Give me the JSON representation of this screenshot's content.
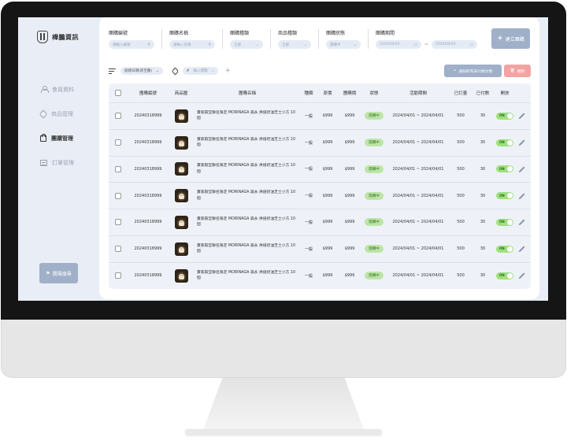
{
  "app": {
    "logo_text": "樺鵬資訊"
  },
  "sidebar": {
    "items": [
      {
        "label": "會員資料",
        "icon": "user-icon",
        "active": false
      },
      {
        "label": "商品管理",
        "icon": "tag-icon",
        "active": false
      },
      {
        "label": "團購管理",
        "icon": "bag-icon",
        "active": true
      },
      {
        "label": "訂單管理",
        "icon": "order-icon",
        "active": false
      }
    ],
    "bottom_button": "開場搜尋"
  },
  "filters": {
    "id": {
      "label": "團購編號",
      "placeholder": "請輸入編號"
    },
    "name": {
      "label": "團購名稱",
      "placeholder": "請輸入名稱"
    },
    "type": {
      "label": "團購種類",
      "value": "全部"
    },
    "product_type": {
      "label": "商品種類",
      "value": "全部"
    },
    "status": {
      "label": "團購狀態",
      "value": "團購中"
    },
    "period": {
      "label": "團購期間",
      "start": "2024/04/01",
      "end": "2024/04/01",
      "sep": "~"
    }
  },
  "actions": {
    "create": "建立團購",
    "notify": "通知所有未付款付款",
    "delete": "刪除"
  },
  "toolbar": {
    "sort": "創建日期(新至舊)",
    "tag_placeholder": "輸入標籤",
    "tag_prefix": "#"
  },
  "table": {
    "headers": [
      "團購編號",
      "商品圖",
      "團購名稱",
      "種類",
      "原價",
      "團購價",
      "狀態",
      "活動期間",
      "已訂量",
      "已付數",
      "開放"
    ],
    "rows": [
      {
        "id": "20240318999",
        "name": "賣家殿堂聯名限定 MORINAGA 森永 烘焙奶油芝士小方 10個",
        "type": "一般",
        "price": "$999",
        "group_price": "$999",
        "status": "團購中",
        "period": "2024/04/01 ~ 2024/04/01",
        "ordered": "500",
        "paid": "30",
        "open": "ON"
      },
      {
        "id": "20240318999",
        "name": "賣家殿堂聯名限定 MORINAGA 森永 烘焙奶油芝士小方 10個",
        "type": "一般",
        "price": "$999",
        "group_price": "$999",
        "status": "團購中",
        "period": "2024/04/01 ~ 2024/04/01",
        "ordered": "500",
        "paid": "30",
        "open": "ON"
      },
      {
        "id": "20240318999",
        "name": "賣家殿堂聯名限定 MORINAGA 森永 烘焙奶油芝士小方 10個",
        "type": "一般",
        "price": "$999",
        "group_price": "$999",
        "status": "團購中",
        "period": "2024/04/01 ~ 2024/04/01",
        "ordered": "500",
        "paid": "30",
        "open": "ON"
      },
      {
        "id": "20240318999",
        "name": "賣家殿堂聯名限定 MORINAGA 森永 烘焙奶油芝士小方 10個",
        "type": "一般",
        "price": "$999",
        "group_price": "$999",
        "status": "團購中",
        "period": "2024/04/01 ~ 2024/04/01",
        "ordered": "500",
        "paid": "30",
        "open": "ON"
      },
      {
        "id": "20240318999",
        "name": "賣家殿堂聯名限定 MORINAGA 森永 烘焙奶油芝士小方 10個",
        "type": "一般",
        "price": "$999",
        "group_price": "$999",
        "status": "團購中",
        "period": "2024/04/01 ~ 2024/04/01",
        "ordered": "500",
        "paid": "30",
        "open": "ON"
      },
      {
        "id": "20240318999",
        "name": "賣家殿堂聯名限定 MORINAGA 森永 烘焙奶油芝士小方 10個",
        "type": "一般",
        "price": "$999",
        "group_price": "$999",
        "status": "團購中",
        "period": "2024/04/01 ~ 2024/04/01",
        "ordered": "500",
        "paid": "30",
        "open": "ON"
      },
      {
        "id": "20240318999",
        "name": "賣家殿堂聯名限定 MORINAGA 森永 烘焙奶油芝士小方 10個",
        "type": "一般",
        "price": "$999",
        "group_price": "$999",
        "status": "團購中",
        "period": "2024/04/01 ~ 2024/04/01",
        "ordered": "500",
        "paid": "30",
        "open": "ON"
      }
    ]
  },
  "colors": {
    "accent": "#9fb0c8",
    "danger": "#f4a3a3",
    "status_green": "#bde5a6",
    "toggle_on": "#9ee07d",
    "screen_bg": "#e9eef6"
  }
}
